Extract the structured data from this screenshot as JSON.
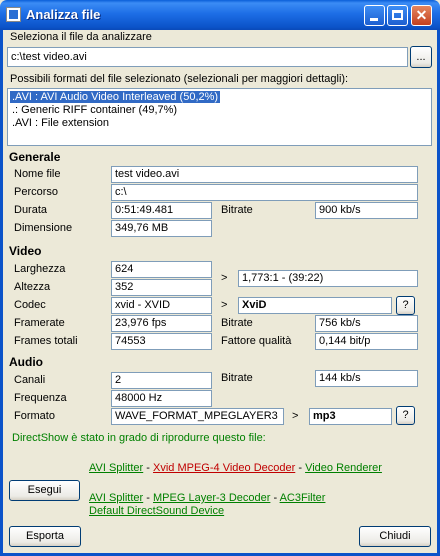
{
  "window": {
    "title": "Analizza file"
  },
  "file_select": {
    "label": "Seleziona il file da analizzare",
    "path": "c:\\test video.avi",
    "browse_label": "..."
  },
  "formats": {
    "label": "Possibili formati del file selezionato (selezionali per maggiori dettagli):",
    "items": [
      {
        "text": ".AVI : AVI Audio Video Interleaved (50,2%)",
        "selected": true
      },
      {
        "text": ".: Generic RIFF container (49,7%)",
        "selected": false
      },
      {
        "text": ".AVI : File extension",
        "selected": false
      }
    ]
  },
  "general": {
    "heading": "Generale",
    "name_label": "Nome file",
    "name": "test video.avi",
    "path_label": "Percorso",
    "path": "c:\\",
    "duration_label": "Durata",
    "duration": "0:51:49.481",
    "bitrate_label": "Bitrate",
    "bitrate": "900 kb/s",
    "size_label": "Dimensione",
    "size": "349,76 MB"
  },
  "video": {
    "heading": "Video",
    "width_label": "Larghezza",
    "width": "624",
    "height_label": "Altezza",
    "height": "352",
    "arrow": ">",
    "aspect": "1,773:1 - (39:22)",
    "codec_label": "Codec",
    "codec": "xvid - XVID",
    "codec_name": "XviD",
    "codec_help": "?",
    "framerate_label": "Framerate",
    "framerate": "23,976 fps",
    "bitrate_label": "Bitrate",
    "bitrate": "756 kb/s",
    "frames_label": "Frames totali",
    "frames": "74553",
    "quality_label": "Fattore qualità",
    "quality": "0,144 bit/p"
  },
  "audio": {
    "heading": "Audio",
    "channels_label": "Canali",
    "channels": "2",
    "bitrate_label": "Bitrate",
    "bitrate": "144 kb/s",
    "frequency_label": "Frequenza",
    "frequency": "48000 Hz",
    "format_label": "Formato",
    "format": "WAVE_FORMAT_MPEGLAYER3",
    "arrow": ">",
    "format_name": "mp3",
    "format_help": "?"
  },
  "directshow": {
    "message": "DirectShow è stato in grado di riprodurre questo file:",
    "run_label": "Esegui",
    "video_chain": [
      {
        "label": "AVI Splitter",
        "color": "#008000"
      },
      {
        "label": "Xvid MPEG-4 Video Decoder",
        "color": "#c00000"
      },
      {
        "label": "Video Renderer",
        "color": "#008000"
      }
    ],
    "audio_chain": [
      {
        "label": "AVI Splitter",
        "color": "#008000"
      },
      {
        "label": "MPEG Layer-3 Decoder",
        "color": "#008000"
      },
      {
        "label": "AC3Filter",
        "color": "#008000"
      }
    ],
    "audio_chain_extra": "Default DirectSound Device",
    "separator": "-"
  },
  "footer": {
    "export_label": "Esporta",
    "close_label": "Chiudi"
  }
}
